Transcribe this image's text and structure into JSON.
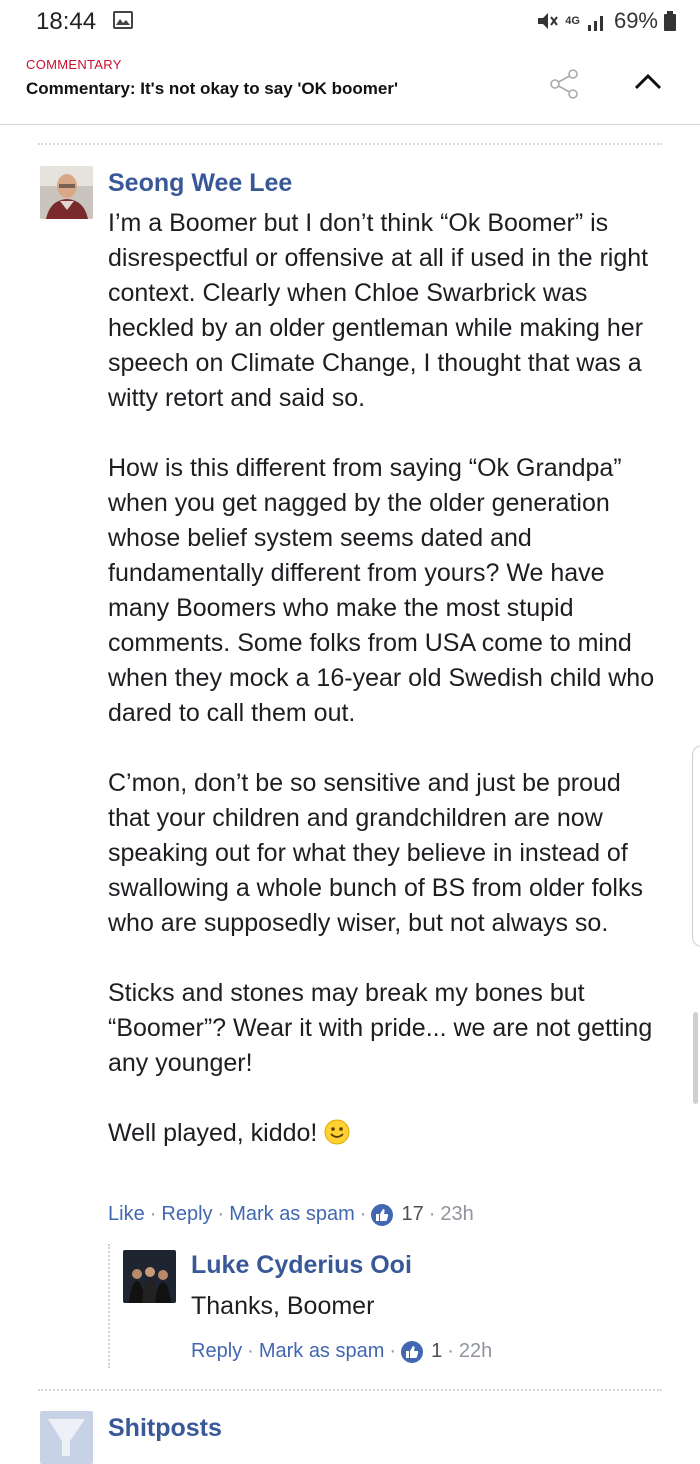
{
  "status_bar": {
    "time": "18:44",
    "network": "4G",
    "battery": "69%",
    "icons": [
      "image-icon",
      "mute-icon",
      "signal-icon",
      "battery-icon"
    ]
  },
  "header": {
    "section": "COMMENTARY",
    "title": "Commentary: It's not okay to say 'OK boomer'",
    "share_icon": "share-icon",
    "collapse_icon": "chevron-up-icon"
  },
  "comment": {
    "author": "Seong Wee Lee",
    "paragraphs": [
      "I’m a Boomer but I don’t think “Ok Boomer” is disrespectful or offensive at all if used in the right context. Clearly when Chloe Swarbrick was heckled by an older gentleman while making her speech on Climate Change, I thought that was a witty retort and said so.",
      "How is this different from saying “Ok Grandpa” when you get nagged by the older generation whose belief system seems dated and fundamentally different from yours? We have many Boomers who make the most stupid comments. Some folks from USA come to mind when they mock a 16-year old Swedish child who dared to call them out.",
      "C’mon, don’t be so sensitive and just be proud that your children and grandchildren are now speaking out for what they believe in instead of swallowing a whole bunch of BS from older folks who are supposedly wiser, but not always so.",
      "Sticks and stones may break my bones but “Boomer”? Wear it with pride... we are not getting any younger!",
      "Well played, kiddo!"
    ],
    "actions": {
      "like": "Like",
      "reply": "Reply",
      "spam": "Mark as spam",
      "likes": "17",
      "time": "23h"
    }
  },
  "reply": {
    "author": "Luke Cyderius Ooi",
    "text": "Thanks, Boomer",
    "actions": {
      "reply": "Reply",
      "spam": "Mark as spam",
      "likes": "1",
      "time": "22h"
    }
  },
  "next_comment": {
    "author": "Shitposts"
  },
  "colors": {
    "link": "#4267b2",
    "name": "#385898",
    "section": "#c8102e"
  }
}
